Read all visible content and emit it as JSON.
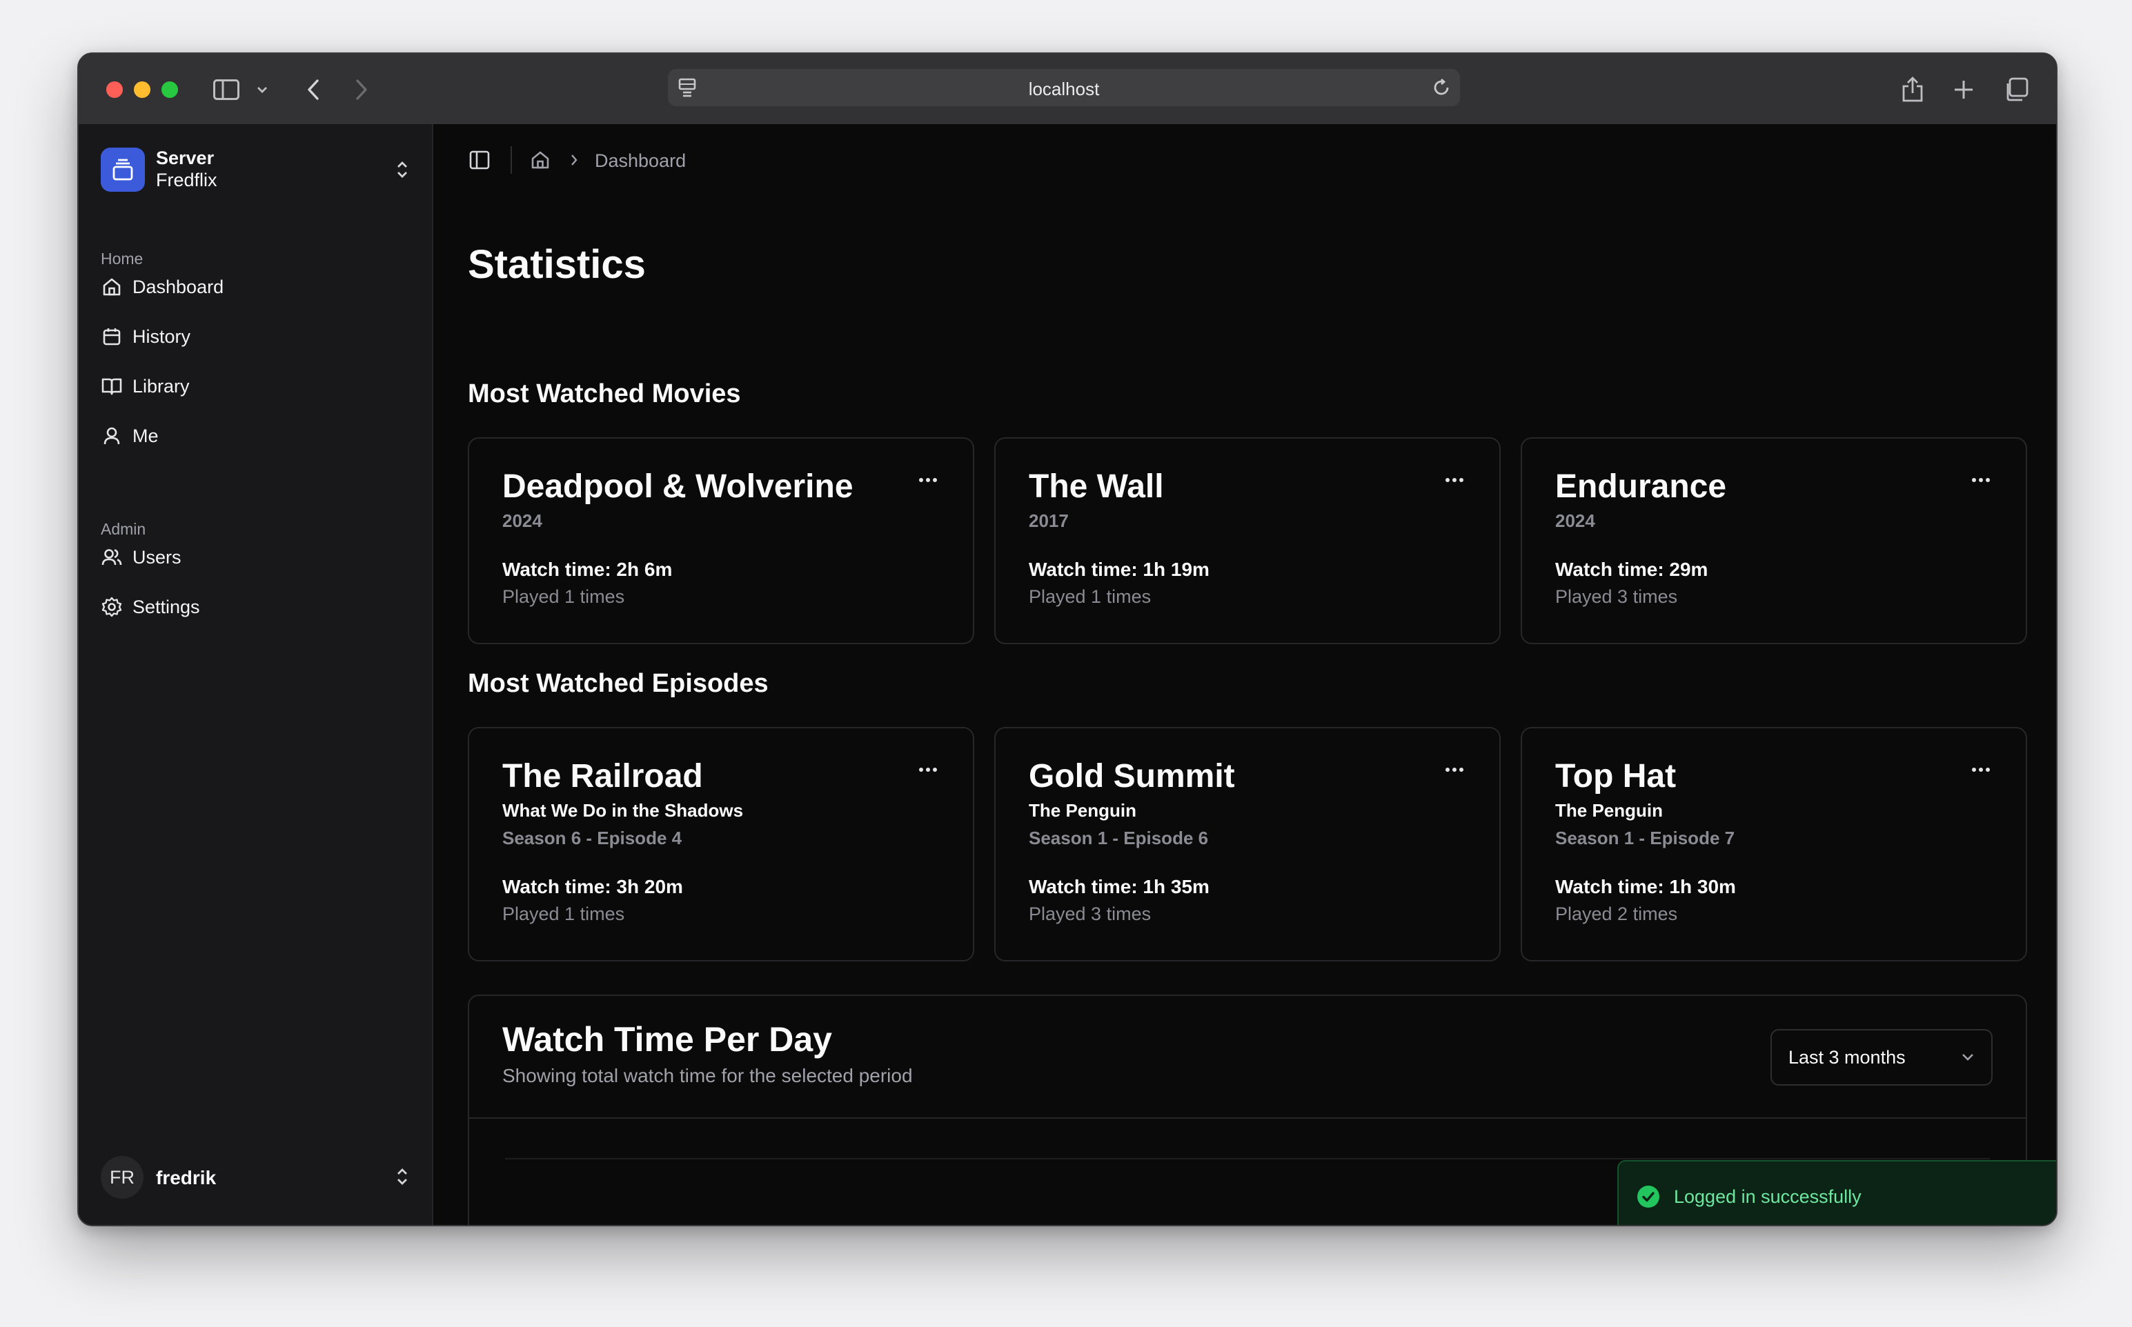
{
  "browser": {
    "url": "localhost"
  },
  "sidebar": {
    "server_name": "Server",
    "server_sub": "Fredflix",
    "groups": [
      {
        "label": "Home",
        "items": [
          {
            "label": "Dashboard",
            "icon": "home-icon"
          },
          {
            "label": "History",
            "icon": "calendar-icon"
          },
          {
            "label": "Library",
            "icon": "book-icon"
          },
          {
            "label": "Me",
            "icon": "user-icon"
          }
        ]
      },
      {
        "label": "Admin",
        "items": [
          {
            "label": "Users",
            "icon": "users-icon"
          },
          {
            "label": "Settings",
            "icon": "gear-icon"
          }
        ]
      }
    ],
    "user": {
      "initials": "FR",
      "name": "fredrik"
    }
  },
  "breadcrumb": {
    "current": "Dashboard"
  },
  "page": {
    "title": "Statistics",
    "movies_heading": "Most Watched Movies",
    "episodes_heading": "Most Watched Episodes"
  },
  "movies": [
    {
      "title": "Deadpool & Wolverine",
      "year": "2024",
      "watch_time": "Watch time: 2h 6m",
      "played": "Played 1 times"
    },
    {
      "title": "The Wall",
      "year": "2017",
      "watch_time": "Watch time: 1h 19m",
      "played": "Played 1 times"
    },
    {
      "title": "Endurance",
      "year": "2024",
      "watch_time": "Watch time: 29m",
      "played": "Played 3 times"
    }
  ],
  "episodes": [
    {
      "title": "The Railroad",
      "series": "What We Do in the Shadows",
      "episode": "Season 6 - Episode 4",
      "watch_time": "Watch time: 3h 20m",
      "played": "Played 1 times"
    },
    {
      "title": "Gold Summit",
      "series": "The Penguin",
      "episode": "Season 1 - Episode 6",
      "watch_time": "Watch time: 1h 35m",
      "played": "Played 3 times"
    },
    {
      "title": "Top Hat",
      "series": "The Penguin",
      "episode": "Season 1 - Episode 7",
      "watch_time": "Watch time: 1h 30m",
      "played": "Played 2 times"
    }
  ],
  "watch_chart": {
    "title": "Watch Time Per Day",
    "subtitle": "Showing total watch time for the selected period",
    "range_selected": "Last 3 months"
  },
  "toast": {
    "message": "Logged in successfully",
    "status": "success"
  },
  "colors": {
    "accent": "#3b5bdb",
    "bar": "#3b63e0",
    "success": "#22c55e"
  }
}
